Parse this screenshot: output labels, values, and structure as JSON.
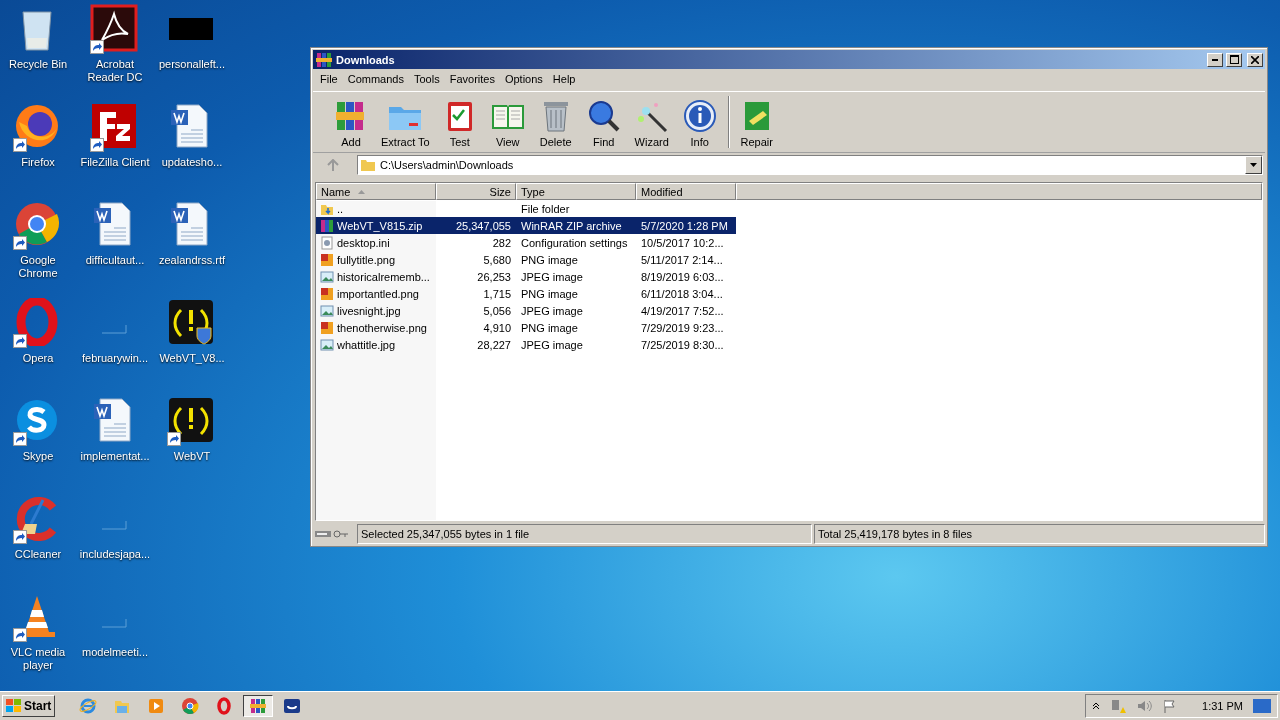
{
  "desktop_icons": [
    {
      "label": "Recycle Bin",
      "kind": "recycle",
      "shortcut": false
    },
    {
      "label": "Firefox",
      "kind": "firefox",
      "shortcut": true
    },
    {
      "label": "Google Chrome",
      "kind": "chrome",
      "shortcut": true
    },
    {
      "label": "Opera",
      "kind": "opera",
      "shortcut": true
    },
    {
      "label": "Skype",
      "kind": "skype",
      "shortcut": true
    },
    {
      "label": "CCleaner",
      "kind": "ccleaner",
      "shortcut": true
    },
    {
      "label": "VLC media player",
      "kind": "vlc",
      "shortcut": true
    },
    {
      "label": "Acrobat Reader DC",
      "kind": "acrobat",
      "shortcut": true
    },
    {
      "label": "FileZilla Client",
      "kind": "filezilla",
      "shortcut": true
    },
    {
      "label": "difficultaut...",
      "kind": "word",
      "shortcut": false
    },
    {
      "label": "februarywin...",
      "kind": "blank",
      "shortcut": false
    },
    {
      "label": "implementat...",
      "kind": "word",
      "shortcut": false
    },
    {
      "label": "includesjapa...",
      "kind": "blank",
      "shortcut": false
    },
    {
      "label": "modelmeeti...",
      "kind": "blank",
      "shortcut": false
    },
    {
      "label": "personalleft...",
      "kind": "black",
      "shortcut": false
    },
    {
      "label": "updatesho...",
      "kind": "word",
      "shortcut": false
    },
    {
      "label": "zealandrss.rtf",
      "kind": "word",
      "shortcut": false
    },
    {
      "label": "WebVT_V8...",
      "kind": "webvt-shield",
      "shortcut": false
    },
    {
      "label": "WebVT",
      "kind": "webvt",
      "shortcut": true
    }
  ],
  "window": {
    "title": "Downloads",
    "menu": [
      "File",
      "Commands",
      "Tools",
      "Favorites",
      "Options",
      "Help"
    ],
    "toolbar": [
      {
        "label": "Add",
        "kind": "add"
      },
      {
        "label": "Extract To",
        "kind": "extract"
      },
      {
        "label": "Test",
        "kind": "test"
      },
      {
        "label": "View",
        "kind": "view"
      },
      {
        "label": "Delete",
        "kind": "delete"
      },
      {
        "label": "Find",
        "kind": "find"
      },
      {
        "label": "Wizard",
        "kind": "wizard"
      },
      {
        "label": "Info",
        "kind": "info"
      }
    ],
    "toolbar_extra": [
      {
        "label": "Repair",
        "kind": "repair"
      }
    ],
    "address": "C:\\Users\\admin\\Downloads",
    "columns": [
      "Name",
      "Size",
      "Type",
      "Modified"
    ],
    "rows": [
      {
        "name": "..",
        "size": "",
        "type": "File folder",
        "modified": "",
        "kind": "folder",
        "selected": false
      },
      {
        "name": "WebVT_V815.zip",
        "size": "25,347,055",
        "type": "WinRAR ZIP archive",
        "modified": "5/7/2020 1:28 PM",
        "kind": "zip",
        "selected": true
      },
      {
        "name": "desktop.ini",
        "size": "282",
        "type": "Configuration settings",
        "modified": "10/5/2017 10:2...",
        "kind": "ini",
        "selected": false
      },
      {
        "name": "fullytitle.png",
        "size": "5,680",
        "type": "PNG image",
        "modified": "5/11/2017 2:14...",
        "kind": "png",
        "selected": false
      },
      {
        "name": "historicalrememb...",
        "size": "26,253",
        "type": "JPEG image",
        "modified": "8/19/2019 6:03...",
        "kind": "jpg",
        "selected": false
      },
      {
        "name": "importantled.png",
        "size": "1,715",
        "type": "PNG image",
        "modified": "6/11/2018 3:04...",
        "kind": "png",
        "selected": false
      },
      {
        "name": "livesnight.jpg",
        "size": "5,056",
        "type": "JPEG image",
        "modified": "4/19/2017 7:52...",
        "kind": "jpg",
        "selected": false
      },
      {
        "name": "thenotherwise.png",
        "size": "4,910",
        "type": "PNG image",
        "modified": "7/29/2019 9:23...",
        "kind": "png",
        "selected": false
      },
      {
        "name": "whattitle.jpg",
        "size": "28,227",
        "type": "JPEG image",
        "modified": "7/25/2019 8:30...",
        "kind": "jpg",
        "selected": false
      }
    ],
    "status_left": "Selected 25,347,055 bytes in 1 file",
    "status_right": "Total 25,419,178 bytes in 8 files"
  },
  "taskbar": {
    "start": "Start",
    "apps": [
      {
        "kind": "ie",
        "selected": false
      },
      {
        "kind": "explorer",
        "selected": false
      },
      {
        "kind": "media",
        "selected": false
      },
      {
        "kind": "chrome",
        "selected": false
      },
      {
        "kind": "opera",
        "selected": false
      },
      {
        "kind": "winrar",
        "selected": true
      },
      {
        "kind": "app",
        "selected": false
      }
    ],
    "clock": "1:31 PM"
  }
}
